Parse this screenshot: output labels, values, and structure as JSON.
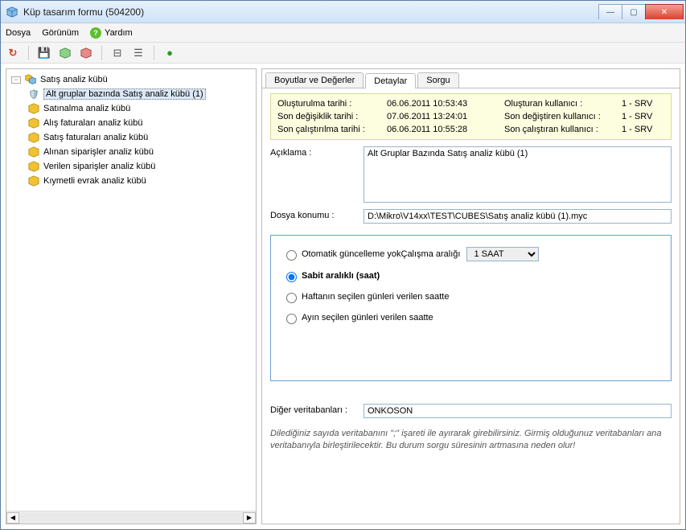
{
  "window": {
    "title": "Küp tasarım formu (504200)"
  },
  "menu": {
    "file": "Dosya",
    "view": "Görünüm",
    "help": "Yardım"
  },
  "tree": {
    "root": "Satış analiz kübü",
    "items": [
      "Alt gruplar bazında Satış analiz kübü (1)",
      "Satınalma analiz kübü",
      "Alış faturaları analiz kübü",
      "Satış faturaları analiz kübü",
      "Alınan siparişler analiz kübü",
      "Verilen siparişler analiz kübü",
      "Kıymetli evrak analiz kübü"
    ],
    "selected_index": 0
  },
  "tabs": {
    "dims": "Boyutlar ve Değerler",
    "details": "Detaylar",
    "query": "Sorgu",
    "active": "details"
  },
  "info": {
    "created_label": "Oluşturulma tarihi :",
    "created_value": "06.06.2011 10:53:43",
    "created_user_label": "Oluşturan kullanıcı :",
    "created_user_value": "1 - SRV",
    "modified_label": "Son değişiklik tarihi :",
    "modified_value": "07.06.2011 13:24:01",
    "modified_user_label": "Son değiştiren kullanıcı :",
    "modified_user_value": "1 - SRV",
    "lastrun_label": "Son çalıştırılma tarihi :",
    "lastrun_value": "06.06.2011 10:55:28",
    "lastrun_user_label": "Son çalıştıran kullanıcı :",
    "lastrun_user_value": "1 - SRV"
  },
  "fields": {
    "desc_label": "Açıklama :",
    "desc_value": "Alt Gruplar Bazında Satış analiz kübü (1)",
    "path_label": "Dosya konumu :",
    "path_value": "D:\\Mikro\\V14xx\\TEST\\CUBES\\Satış analiz kübü (1).myc"
  },
  "schedule": {
    "opt_none": "Otomatik güncelleme yok",
    "opt_fixed": "Sabit aralıklı (saat)",
    "opt_weekly": "Haftanın seçilen günleri  verilen saatte",
    "opt_monthly": "Ayın seçilen günleri verilen saatte",
    "selected": "fixed",
    "interval_label": "Çalışma aralığı",
    "interval_value": "1 SAAT"
  },
  "otherdb": {
    "label": "Diğer veritabanları :",
    "value": "ONKOSON",
    "note": "Dilediğiniz sayıda veritabanını \";\" işareti ile ayırarak girebilirsiniz. Girmiş olduğunuz veritabanları ana veritabanıyla birleştirilecektir. Bu durum sorgu süresinin artmasına neden olur!"
  }
}
